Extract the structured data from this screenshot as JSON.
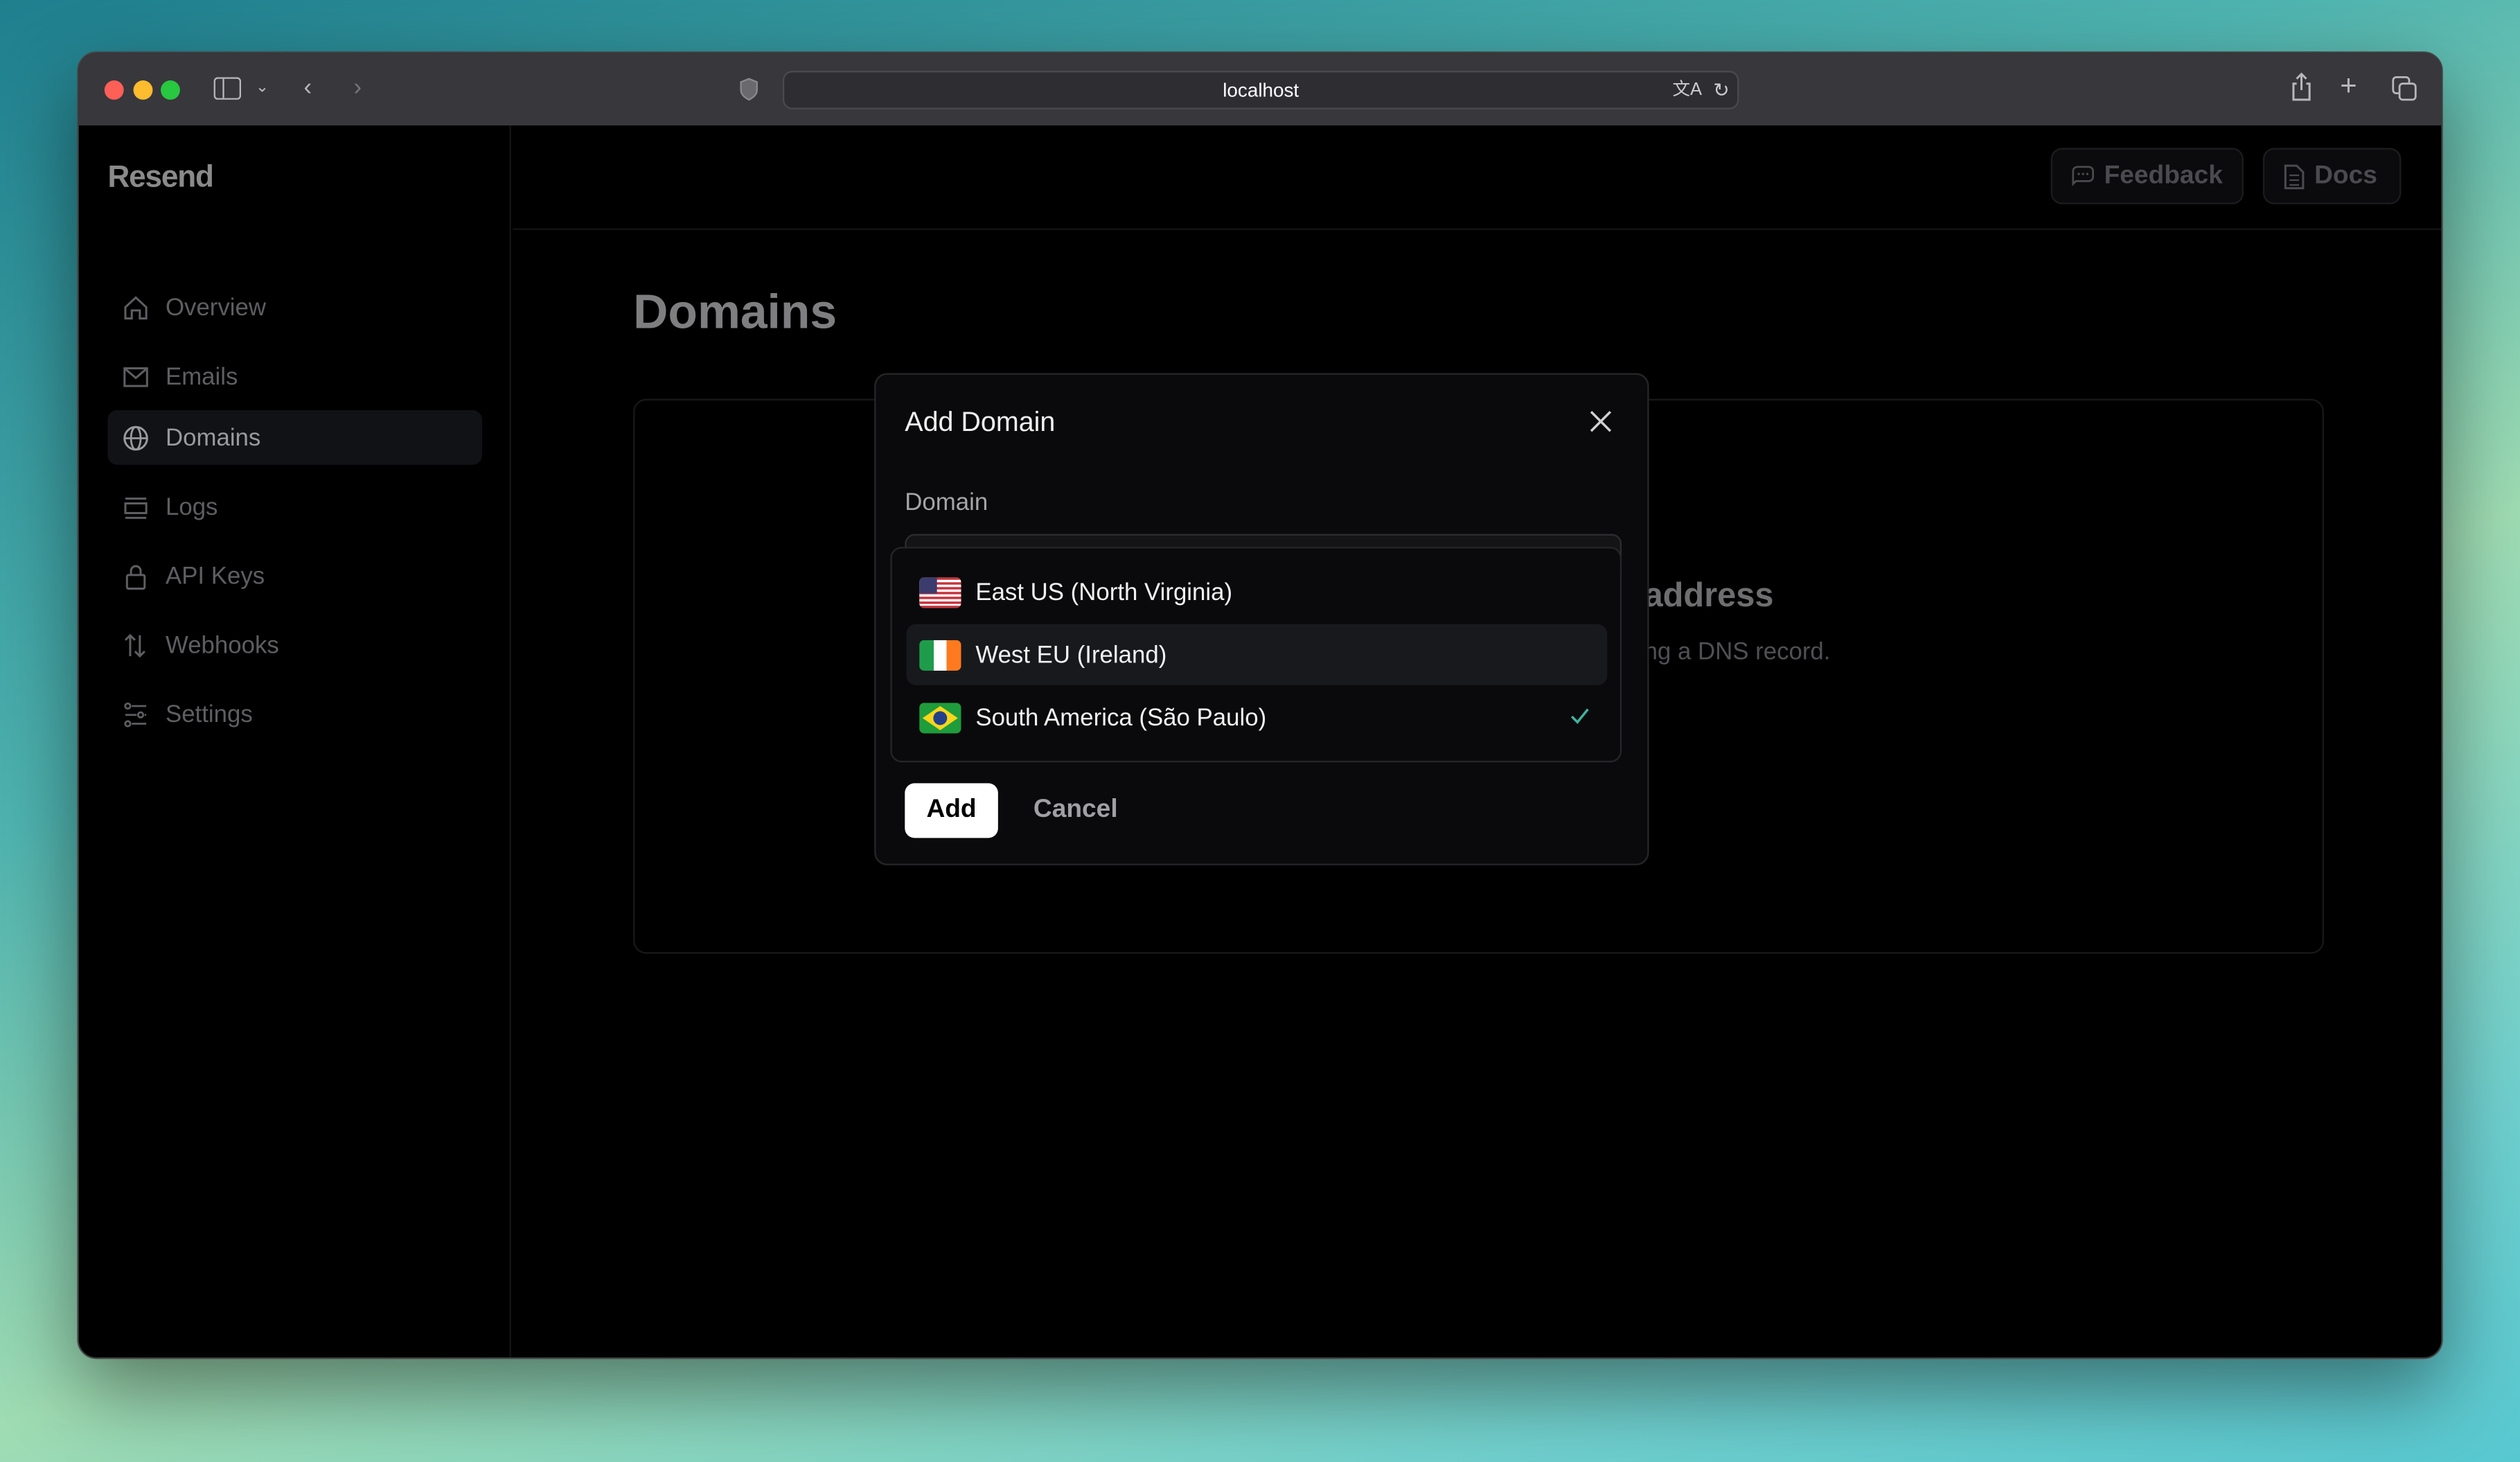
{
  "browser": {
    "url": "localhost"
  },
  "app": {
    "logo": "Resend"
  },
  "sidebar": {
    "items": [
      {
        "label": "Overview",
        "icon": "home-icon"
      },
      {
        "label": "Emails",
        "icon": "mail-icon"
      },
      {
        "label": "Domains",
        "icon": "globe-icon",
        "active": true
      },
      {
        "label": "Logs",
        "icon": "logs-icon"
      },
      {
        "label": "API Keys",
        "icon": "lock-icon"
      },
      {
        "label": "Webhooks",
        "icon": "arrows-up-down-icon"
      },
      {
        "label": "Settings",
        "icon": "sliders-icon"
      }
    ]
  },
  "header": {
    "feedback_label": "Feedback",
    "docs_label": "Docs"
  },
  "main": {
    "title": "Domains",
    "card_heading_fragment": "address",
    "card_text_fragment": "ng a DNS record."
  },
  "modal": {
    "title": "Add Domain",
    "domain_label": "Domain",
    "regions": [
      {
        "label": "East US (North Virginia)",
        "flag": "us"
      },
      {
        "label": "West EU (Ireland)",
        "flag": "ie",
        "highlighted": true
      },
      {
        "label": "South America (São Paulo)",
        "flag": "br",
        "selected": true
      }
    ],
    "add_label": "Add",
    "cancel_label": "Cancel"
  },
  "colors": {
    "check": "#3fb3a0",
    "background": "#000000",
    "titlebar": "#38373c"
  }
}
